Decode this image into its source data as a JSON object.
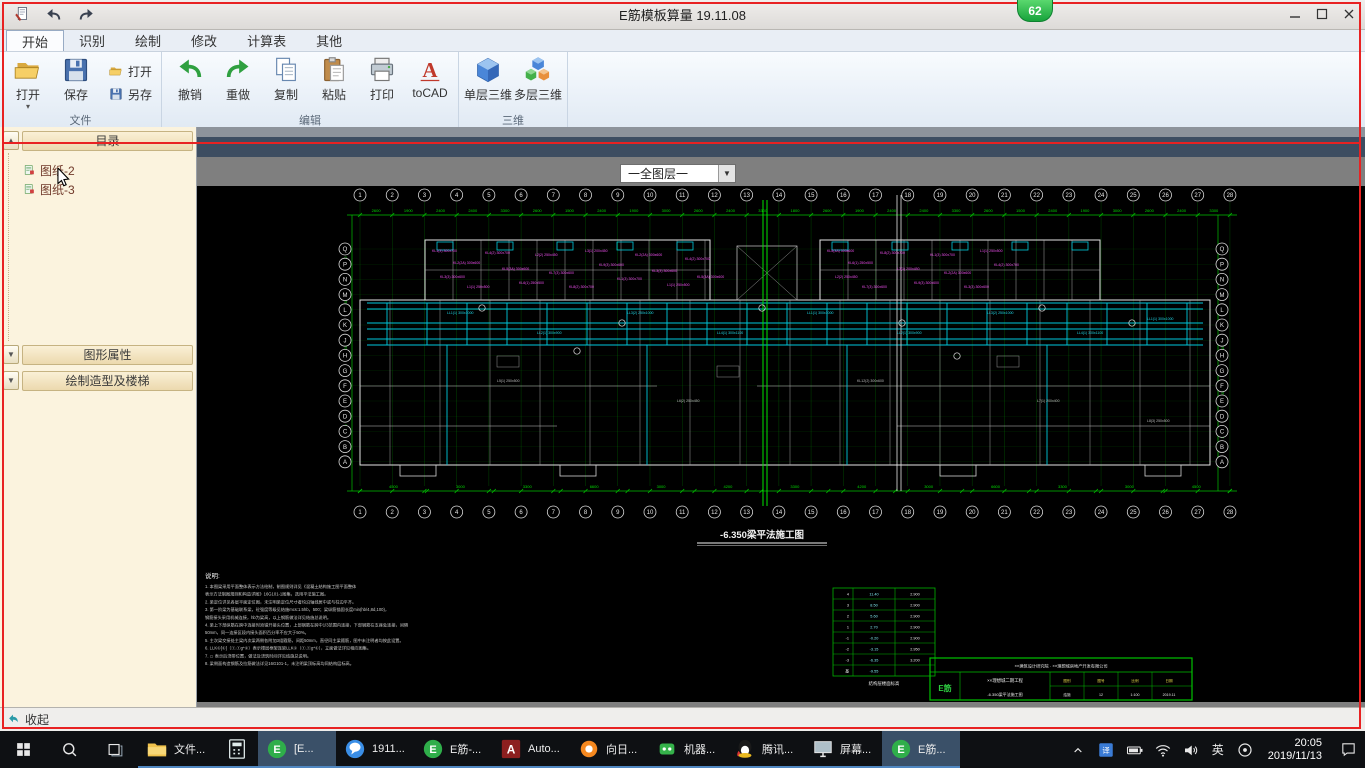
{
  "titlebar": {
    "title": "E筋模板算量 19.11.08",
    "badge": "62"
  },
  "ribbon": {
    "tabs": [
      {
        "key": "start",
        "label": "开始",
        "active": true
      },
      {
        "key": "recognize",
        "label": "识别"
      },
      {
        "key": "draw",
        "label": "绘制"
      },
      {
        "key": "modify",
        "label": "修改"
      },
      {
        "key": "calc-table",
        "label": "计算表"
      },
      {
        "key": "other",
        "label": "其他"
      }
    ],
    "groups": {
      "file": {
        "label": "文件",
        "big": [
          {
            "key": "open",
            "label": "打开",
            "icon": "folder-open",
            "menu": true
          },
          {
            "key": "save",
            "label": "保存",
            "icon": "save"
          }
        ],
        "small": [
          {
            "key": "open-small",
            "label": "打开",
            "icon": "folder-open"
          },
          {
            "key": "save-as",
            "label": "另存",
            "icon": "save"
          }
        ]
      },
      "edit": {
        "label": "编辑",
        "big": [
          {
            "key": "undo",
            "label": "撤销",
            "icon": "undo"
          },
          {
            "key": "redo",
            "label": "重做",
            "icon": "redo"
          },
          {
            "key": "copy",
            "label": "复制",
            "icon": "copy"
          },
          {
            "key": "paste",
            "label": "粘贴",
            "icon": "paste"
          },
          {
            "key": "print",
            "label": "打印",
            "icon": "print"
          },
          {
            "key": "tocad",
            "label": "toCAD",
            "icon": "tocad"
          }
        ]
      },
      "threed": {
        "label": "三维",
        "big": [
          {
            "key": "single-3d",
            "label": "单层三维",
            "icon": "cube-single"
          },
          {
            "key": "multi-3d",
            "label": "多层三维",
            "icon": "cube-multi"
          }
        ]
      }
    }
  },
  "sidebar": {
    "panels": [
      {
        "key": "catalog",
        "title": "目录",
        "items": [
          {
            "label": "图纸-2"
          },
          {
            "label": "图纸-3"
          }
        ]
      },
      {
        "key": "properties",
        "title": "图形属性"
      },
      {
        "key": "modeling",
        "title": "绘制造型及楼梯"
      }
    ]
  },
  "canvas": {
    "layer_dropdown": "一全图层一"
  },
  "statusbar": {
    "collapse_label": "收起"
  },
  "taskbar": {
    "items": [
      {
        "key": "start",
        "icon": "start",
        "type": "system"
      },
      {
        "key": "search",
        "icon": "search",
        "type": "system"
      },
      {
        "key": "task-view",
        "icon": "taskview",
        "type": "system"
      },
      {
        "key": "file-explorer",
        "icon": "folder",
        "label": "文件..."
      },
      {
        "key": "calculator",
        "icon": "calc",
        "type": "icononly"
      },
      {
        "key": "ejin-window-1",
        "icon": "ejin",
        "label": "[E...",
        "selected": true
      },
      {
        "key": "tim-1911",
        "icon": "tim",
        "label": "1911..."
      },
      {
        "key": "ejin-window-2",
        "icon": "ejin",
        "label": "E筋-..."
      },
      {
        "key": "autocad",
        "icon": "acad",
        "label": "Auto..."
      },
      {
        "key": "sunflower-remote",
        "icon": "sunflower",
        "label": "向日..."
      },
      {
        "key": "robot",
        "icon": "robot",
        "label": "机器..."
      },
      {
        "key": "tencent",
        "icon": "qq",
        "label": "腾讯..."
      },
      {
        "key": "screen-recorder",
        "icon": "screen",
        "label": "屏幕..."
      },
      {
        "key": "ejin-window-3",
        "icon": "ejin",
        "label": "E筋...",
        "selected": true
      }
    ],
    "tray": {
      "ime": "英",
      "time": "20:05",
      "date": "2019/11/13"
    }
  },
  "cad": {
    "drawing_title": "-6.350梁平法施工图",
    "notes_title": "说明:",
    "notes": [
      "1. 本图梁采用平面整体表示方法绘制，制图规则详见《混凝土结构施工图平面整体",
      "   表示方法制图规则和构造详图》16G101-1图集，选用平法施工图。",
      "2. 梁定位详见各层平面定位图，未注明梁定位尺寸者均沿轴线居中或与柱边平齐。",
      "3. 第一阶梁为基础联系梁，砼强度等级见结施mcs:1.5hb，500；梁纵筋锚固长度min(hb/4,8d,100)，",
      "   钢筋接头采用机械连接，hb为梁高，以上钢筋做法详见结施总说明。",
      "4. 梁上下部纵筋在跨中连接时须错开接头位置，上部钢筋在跨中1/3范围内连接，下部钢筋在支座处连接，间隔",
      "   50mm，同一连接区段内接头面积百分率不应大于50%。",
      "5. 主次梁交接处主梁内次梁两侧各附加3组箍筋，间距50mm，直径同主梁箍筋，图中未注明者均按此设置。",
      "6. LLK①[①]（①.①g*①）表示楼层框架连梁LLK①（①.①g*①），立面做法详见相应图集。",
      "7. ▭ 表示后浇带位置，做法及浇筑时间详见结施总说明。",
      "8. 梁侧面构造钢筋及拉筋做法详见16G101-1，未注明梁顶标高均同结构层标高。"
    ],
    "grid_numbers": [
      "1",
      "2",
      "3",
      "4",
      "5",
      "6",
      "7",
      "8",
      "9",
      "10",
      "11",
      "12",
      "13",
      "14",
      "15",
      "16",
      "17",
      "18",
      "19",
      "20",
      "21",
      "22",
      "23",
      "24",
      "25",
      "26",
      "27",
      "28"
    ],
    "grid_letters": [
      "Q",
      "P",
      "N",
      "M",
      "L",
      "K",
      "J",
      "H",
      "G",
      "F",
      "E",
      "D",
      "C",
      "B",
      "A"
    ],
    "top_dims": [
      "2600",
      "1900",
      "2400",
      "2400",
      "3300",
      "2600",
      "1500",
      "2400",
      "1900",
      "3000",
      "2600",
      "2400",
      "3300",
      "1800"
    ],
    "bottom_dims": [
      "4500",
      "3000",
      "3300",
      "6600",
      "3000",
      "4200",
      "3300",
      "4200",
      "3000",
      "6600",
      "3300",
      "3000",
      "4500"
    ],
    "left_dims": [
      "2100",
      "1500",
      "3300",
      "3000",
      "2400"
    ],
    "beam_labels": [
      "KL1(3) 300x700",
      "KL2(2A) 300x600",
      "KL3(3) 300x600",
      "L1(1) 250x500",
      "KL4(2) 300x700",
      "KL5(3A) 300x600",
      "KL6(1) 250x500",
      "L2(2) 250x450",
      "KL7(3) 300x600",
      "KL8(2) 300x700",
      "L3(1) 200x450",
      "KL9(3) 300x600"
    ],
    "band_labels": [
      "LL1(1) 300x1000",
      "LL2(1) 300x900",
      "LL3(2) 250x1000",
      "LL4(1) 300x1100"
    ],
    "room_labels": [
      "L5(1) 250x500",
      "L6(2) 250x450",
      "KL12(2) 300x600",
      "L7(1) 200x400",
      "L8(3) 250x500"
    ],
    "level_table": {
      "caption": "结构层楼面标高",
      "rows": [
        [
          "4",
          "11.40",
          "2.900"
        ],
        [
          "3",
          "8.50",
          "2.900"
        ],
        [
          "2",
          "5.60",
          "2.900"
        ],
        [
          "1",
          "2.70",
          "2.900"
        ],
        [
          "-1",
          "-0.20",
          "2.900"
        ],
        [
          "-2",
          "-3.15",
          "2.950"
        ],
        [
          "-3",
          "-6.35",
          "3.200"
        ],
        [
          "基",
          "-9.55",
          ""
        ]
      ]
    },
    "titleblock": {
      "company": "××建筑设计研究院 · ××理想城房地产开发有限公司",
      "logo": "E筋",
      "project": "××理想城二期工程",
      "drawing": "-6.350梁平法施工图",
      "cols": [
        {
          "k": "图别",
          "v": "结施"
        },
        {
          "k": "图号",
          "v": "12"
        },
        {
          "k": "比例",
          "v": "1:100"
        },
        {
          "k": "日期",
          "v": "2019.11"
        }
      ]
    }
  }
}
